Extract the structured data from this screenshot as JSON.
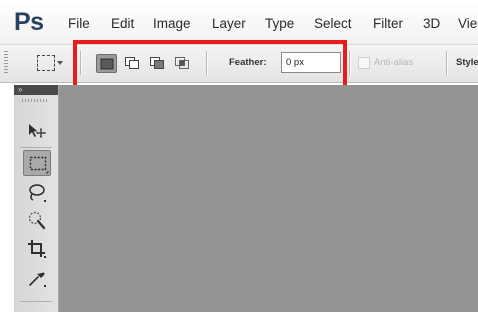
{
  "app": {
    "logo_text": "Ps"
  },
  "menu": {
    "items": [
      {
        "label": "File"
      },
      {
        "label": "Edit"
      },
      {
        "label": "Image"
      },
      {
        "label": "Layer"
      },
      {
        "label": "Type"
      },
      {
        "label": "Select"
      },
      {
        "label": "Filter"
      },
      {
        "label": "3D"
      },
      {
        "label": "Vie"
      }
    ]
  },
  "options_bar": {
    "tool_preset_icon": "rectangular-marquee-icon",
    "selection_modes": [
      {
        "name": "new-selection",
        "icon": "new-selection-icon",
        "active": true
      },
      {
        "name": "add-to-selection",
        "icon": "add-to-selection-icon",
        "active": false
      },
      {
        "name": "subtract-from-selection",
        "icon": "subtract-from-selection-icon",
        "active": false
      },
      {
        "name": "intersect-with-selection",
        "icon": "intersect-with-selection-icon",
        "active": false
      }
    ],
    "feather_label": "Feather:",
    "feather_value": "0 px",
    "antialias_label": "Anti-alias",
    "antialias_checked": false,
    "antialias_enabled": false,
    "style_label": "Style:"
  },
  "tools_panel": {
    "collapse_glyph": "»",
    "tools": [
      {
        "name": "move-tool",
        "icon": "move-icon",
        "active": false
      },
      {
        "name": "rectangular-marquee-tool",
        "icon": "rectangular-marquee-icon",
        "active": true
      },
      {
        "name": "lasso-tool",
        "icon": "lasso-icon",
        "active": false
      },
      {
        "name": "quick-selection-tool",
        "icon": "quick-selection-icon",
        "active": false
      },
      {
        "name": "crop-tool",
        "icon": "crop-icon",
        "active": false
      },
      {
        "name": "eyedropper-tool",
        "icon": "eyedropper-icon",
        "active": false
      }
    ]
  },
  "colors": {
    "highlight": "#e51d1d",
    "logo": "#29435f",
    "canvas": "#949494"
  }
}
